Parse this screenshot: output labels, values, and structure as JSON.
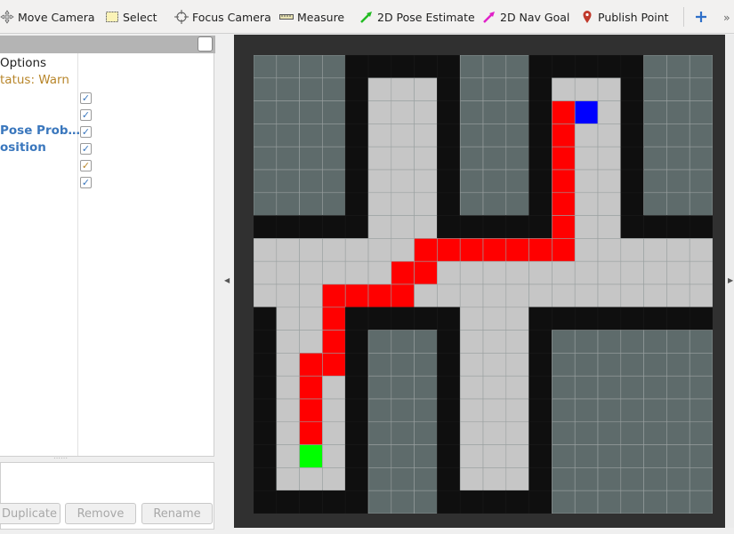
{
  "toolbar": {
    "tools": [
      {
        "label": "Move Camera",
        "icon": "move-camera-icon",
        "name": "move-camera"
      },
      {
        "label": "Select",
        "icon": "select-icon",
        "name": "select"
      },
      {
        "label": "Focus Camera",
        "icon": "focus-camera-icon",
        "name": "focus-camera"
      },
      {
        "label": "Measure",
        "icon": "ruler-icon",
        "name": "measure"
      },
      {
        "label": "2D Pose Estimate",
        "icon": "green-arrow-icon",
        "name": "pose-estimate"
      },
      {
        "label": "2D Nav Goal",
        "icon": "magenta-arrow-icon",
        "name": "nav-goal"
      },
      {
        "label": "Publish Point",
        "icon": "map-pin-icon",
        "name": "publish-point"
      }
    ],
    "add_icon": "plus-icon",
    "overflow_label": "»"
  },
  "tree": {
    "rows": [
      {
        "text": "Options",
        "color": "#222222",
        "bold": false,
        "checked": false
      },
      {
        "text": "tatus: Warn",
        "color": "#b8862b",
        "bold": false,
        "checked": false
      },
      {
        "text": "",
        "color": "#222222",
        "bold": false,
        "checked": true
      },
      {
        "text": "",
        "color": "#222222",
        "bold": false,
        "checked": true
      },
      {
        "text": "Pose Prob…",
        "color": "#3a77bd",
        "bold": true,
        "checked": true
      },
      {
        "text": "osition",
        "color": "#3a77bd",
        "bold": true,
        "checked": true
      },
      {
        "text": "",
        "color": "#222222",
        "bold": false,
        "checked": true,
        "warn": true
      },
      {
        "text": "",
        "color": "#222222",
        "bold": false,
        "checked": true
      }
    ],
    "checkmark": "✓"
  },
  "buttons": {
    "duplicate": "Duplicate",
    "remove": "Remove",
    "rename": "Rename"
  },
  "map": {
    "colors": {
      "unknown": "#5e6b6b",
      "occupied": "#0f0f0f",
      "free": "#c6c6c6",
      "path": "#ff0000",
      "start": "#00ff00",
      "goal": "#0000ff",
      "gridline": "#9aa0a0",
      "background": "#303030"
    },
    "rows": [
      "UUUUOOOOOUUUOOOOOUUU",
      "UUUUOFFFOUUUOFFFOUUU",
      "UUUUOFFFOUUUOPGFOUUU",
      "UUUUOFFFOUUUOPFFOUUU",
      "UUUUOFFFOUUUOPFFOUUU",
      "UUUUOFFFOUUUOPFFOUUU",
      "UUUUOFFFOUUUOPFFOUUU",
      "OOOOOFFFOOOOOPFFOOOO",
      "FFFFFFFPPPPPPPFFFFFF",
      "FFFFFFPPFFFFFFFFFFFF",
      "FFFPPPPFFFFFFFFFFFFF",
      "OFFPOOOOOFFFOOOOOOOO",
      "OFFPOUUUOFFFOUUUUUUU",
      "OFPPOUUUOFFFOUUUUUUU",
      "OFPFOUUUOFFFOUUUUUUU",
      "OFPFOUUUOFFFOUUUUUUU",
      "OFPFOUUUOFFFOUUUUUUU",
      "OFSFOUUUOFFFOUUUUUUU",
      "OFFFOUUUOFFFOUUUUUUU",
      "OOOOOUUUOOOOOUUUUUUU"
    ]
  }
}
